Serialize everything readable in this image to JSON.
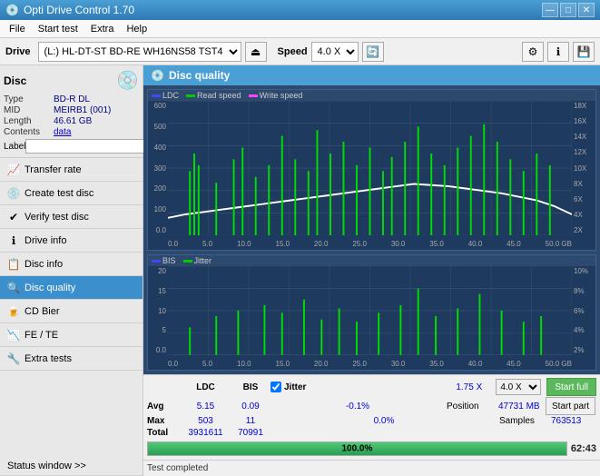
{
  "app": {
    "title": "Opti Drive Control 1.70",
    "titlebar_icon": "💿"
  },
  "titlebar": {
    "minimize": "—",
    "maximize": "□",
    "close": "✕"
  },
  "menu": {
    "items": [
      "File",
      "Start test",
      "Extra",
      "Help"
    ]
  },
  "toolbar": {
    "drive_label": "Drive",
    "drive_value": "(L:)  HL-DT-ST BD-RE  WH16NS58 TST4",
    "speed_label": "Speed",
    "speed_value": "4.0 X"
  },
  "disc": {
    "title": "Disc",
    "type_label": "Type",
    "type_value": "BD-R DL",
    "mid_label": "MID",
    "mid_value": "MEIRB1 (001)",
    "length_label": "Length",
    "length_value": "46.61 GB",
    "contents_label": "Contents",
    "contents_value": "data",
    "label_label": "Label",
    "label_value": ""
  },
  "nav": {
    "items": [
      {
        "id": "transfer-rate",
        "label": "Transfer rate",
        "icon": "📈"
      },
      {
        "id": "create-test-disc",
        "label": "Create test disc",
        "icon": "💿"
      },
      {
        "id": "verify-test-disc",
        "label": "Verify test disc",
        "icon": "✔"
      },
      {
        "id": "drive-info",
        "label": "Drive info",
        "icon": "ℹ"
      },
      {
        "id": "disc-info",
        "label": "Disc info",
        "icon": "📋"
      },
      {
        "id": "disc-quality",
        "label": "Disc quality",
        "icon": "🔍",
        "active": true
      },
      {
        "id": "cd-bier",
        "label": "CD Bier",
        "icon": "🍺"
      },
      {
        "id": "fe-te",
        "label": "FE / TE",
        "icon": "📉"
      },
      {
        "id": "extra-tests",
        "label": "Extra tests",
        "icon": "🔧"
      }
    ]
  },
  "status_window": {
    "label": "Status window >>"
  },
  "content": {
    "title": "Disc quality"
  },
  "chart1": {
    "legend": [
      {
        "id": "ldc",
        "label": "LDC",
        "color": "#4444ff"
      },
      {
        "id": "read-speed",
        "label": "Read speed",
        "color": "#00cc00"
      },
      {
        "id": "write-speed",
        "label": "Write speed",
        "color": "#ff44ff"
      }
    ],
    "y_max_left": "600",
    "y_labels_left": [
      "600",
      "500",
      "400",
      "300",
      "200",
      "100",
      "0.0"
    ],
    "y_labels_right": [
      "18X",
      "16X",
      "14X",
      "12X",
      "10X",
      "8X",
      "6X",
      "4X",
      "2X"
    ],
    "x_labels": [
      "0.0",
      "5.0",
      "10.0",
      "15.0",
      "20.0",
      "25.0",
      "30.0",
      "35.0",
      "40.0",
      "45.0",
      "50.0 GB"
    ]
  },
  "chart2": {
    "legend": [
      {
        "id": "bis",
        "label": "BIS",
        "color": "#4444ff"
      },
      {
        "id": "jitter",
        "label": "Jitter",
        "color": "#00cc00"
      }
    ],
    "y_labels_left": [
      "20",
      "15",
      "10",
      "5",
      "0.0"
    ],
    "y_labels_right": [
      "10%",
      "8%",
      "6%",
      "4%",
      "2%"
    ],
    "x_labels": [
      "0.0",
      "5.0",
      "10.0",
      "15.0",
      "20.0",
      "25.0",
      "30.0",
      "35.0",
      "40.0",
      "45.0",
      "50.0 GB"
    ]
  },
  "stats": {
    "headers": [
      "",
      "LDC",
      "BIS",
      "",
      "Jitter",
      "Speed"
    ],
    "avg_label": "Avg",
    "avg_ldc": "5.15",
    "avg_bis": "0.09",
    "avg_jitter": "-0.1%",
    "max_label": "Max",
    "max_ldc": "503",
    "max_bis": "11",
    "max_jitter": "0.0%",
    "total_label": "Total",
    "total_ldc": "3931611",
    "total_bis": "70991",
    "speed_value": "1.75 X",
    "speed_select": "4.0 X",
    "position_label": "Position",
    "position_value": "47731 MB",
    "samples_label": "Samples",
    "samples_value": "763513",
    "jitter_checked": true
  },
  "buttons": {
    "start_full": "Start full",
    "start_part": "Start part"
  },
  "progress": {
    "value": "100.0%",
    "width_pct": 100
  },
  "status_bar": {
    "left": "Test completed",
    "time": "62:43"
  }
}
